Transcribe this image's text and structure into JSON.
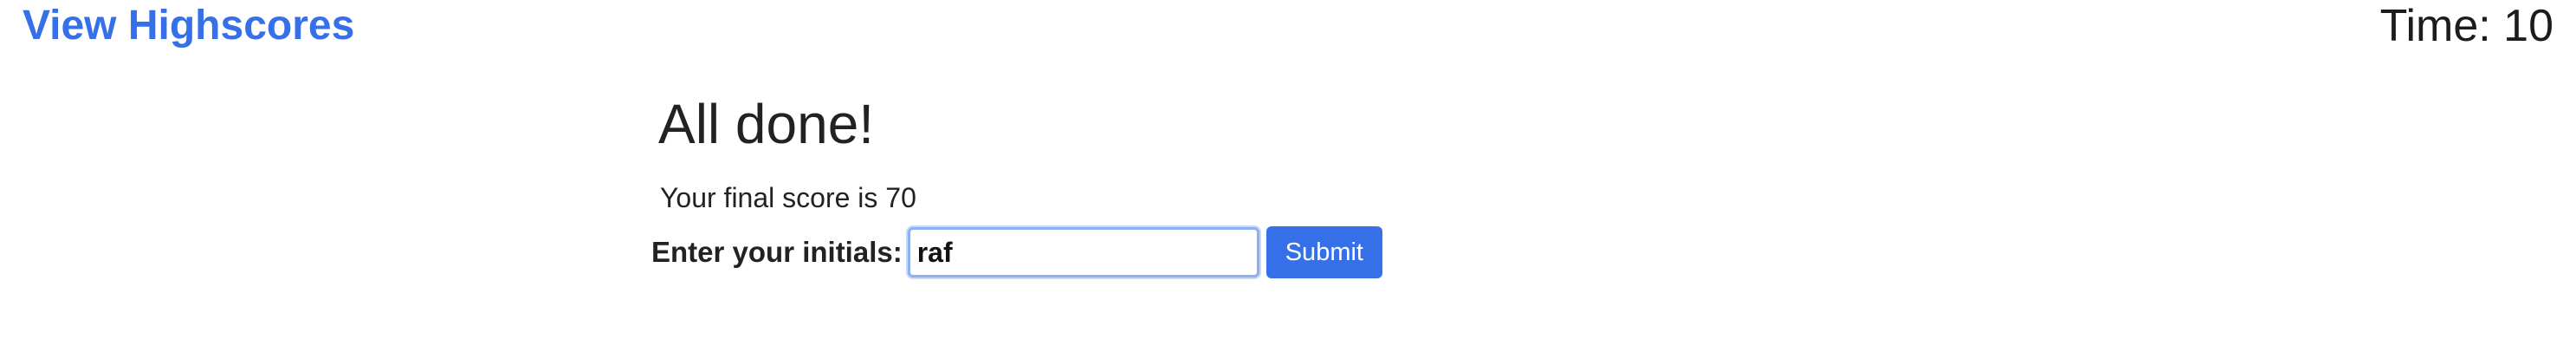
{
  "header": {
    "highscores_link": "View Highscores",
    "timer_label": "Time: 10"
  },
  "result": {
    "title": "All done!",
    "final_score_text": "Your final score is 70"
  },
  "form": {
    "initials_label": "Enter your initials:",
    "initials_value": "raf",
    "submit_label": "Submit"
  },
  "colors": {
    "accent": "#3570e8",
    "input_focus_border": "#8fb0f0",
    "text": "#222222"
  }
}
